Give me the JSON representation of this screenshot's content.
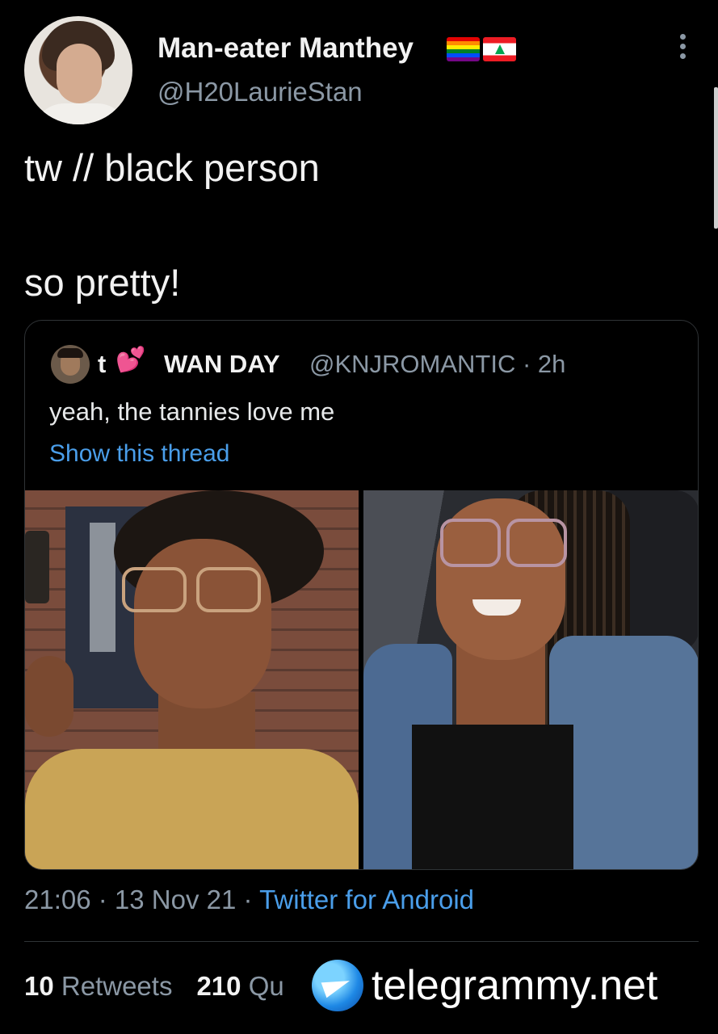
{
  "tweet": {
    "author": {
      "display_name": "Man-eater Manthey",
      "handle": "@H20LaurieStan",
      "flags": [
        "rainbow-flag-icon",
        "lebanon-flag-icon"
      ]
    },
    "line1": "tw  //  black person",
    "line2": "so pretty!",
    "timestamp": "21:06 · 13 Nov 21 · ",
    "source": "Twitter for Android"
  },
  "quote": {
    "name_part1": "t",
    "heart_icon": "two-hearts-icon",
    "name_part2": "WAN DAY",
    "meta": "@KNJROMANTIC · 2h",
    "text": "yeah, the tannies love me",
    "link": "Show this thread"
  },
  "stats": {
    "retweets_count": "10",
    "retweets_label": "Retweets",
    "quotes_count": "210",
    "quotes_label": "Qu"
  },
  "watermark": {
    "text": "telegrammy.net"
  },
  "colors": {
    "background": "#000000",
    "link": "#4a9eea",
    "muted": "#8b98a5"
  }
}
